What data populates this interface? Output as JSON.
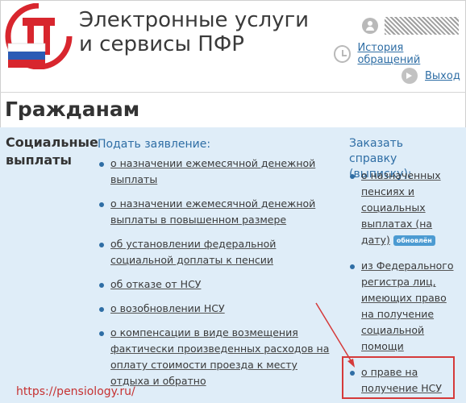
{
  "header": {
    "title_line1": "Электронные услуги",
    "title_line2": "и сервисы ПФР",
    "user_name": "",
    "history_label": "История обращений",
    "exit_label": "Выход"
  },
  "section_title": "Гражданам",
  "category": {
    "line1": "Социальные",
    "line2": "выплаты"
  },
  "column1": {
    "heading": "Подать заявление:",
    "items": [
      "о назначении ежемесячной денежной выплаты",
      "о назначении ежемесячной денежной выплаты в повышенном размере",
      "об установлении федеральной социальной доплаты к пенсии",
      "об отказе от НСУ",
      "о возобновлении НСУ",
      "о компенсации в виде возмещения фактически произведенных расходов на оплату стоимости проезда к месту отдыха и обратно"
    ]
  },
  "column2": {
    "heading": "Заказать справку (выписку):",
    "items": [
      "о назначенных пенсиях и социальных выплатах (на дату)",
      "из Федерального регистра лиц, имеющих право на получение социальной помощи",
      "о праве на получение НСУ"
    ],
    "badge": "обновлён"
  },
  "watermark": "https://pensiology.ru/",
  "colors": {
    "link": "#2f6ea5",
    "panel_bg": "#dfedf8",
    "highlight": "#d53a3a",
    "logo_red": "#d8262e",
    "badge_bg": "#4c9bd2"
  }
}
